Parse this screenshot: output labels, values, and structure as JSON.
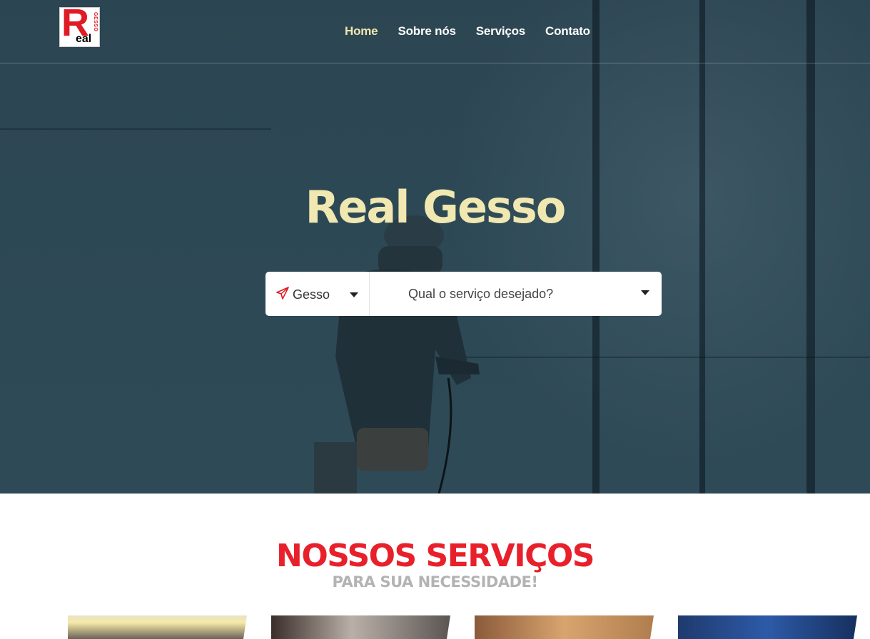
{
  "nav": {
    "logo": {
      "letter": "R",
      "rest": "eal",
      "vertical": "GESSO"
    },
    "items": [
      {
        "label": "Home",
        "active": true
      },
      {
        "label": "Sobre nós",
        "active": false
      },
      {
        "label": "Serviços",
        "active": false
      },
      {
        "label": "Contato",
        "active": false
      }
    ]
  },
  "hero": {
    "title": "Real Gesso",
    "search": {
      "category_icon": "paper-plane-icon",
      "category_value": "Gesso",
      "service_placeholder": "Qual o serviço desejado?"
    }
  },
  "services": {
    "title": "NOSSOS SERVIÇOS",
    "subtitle": "PARA SUA NECESSIDADE!"
  },
  "colors": {
    "accent_red": "#e8202b",
    "title_cream": "#f0e8b0",
    "nav_active": "#eee7b0"
  }
}
